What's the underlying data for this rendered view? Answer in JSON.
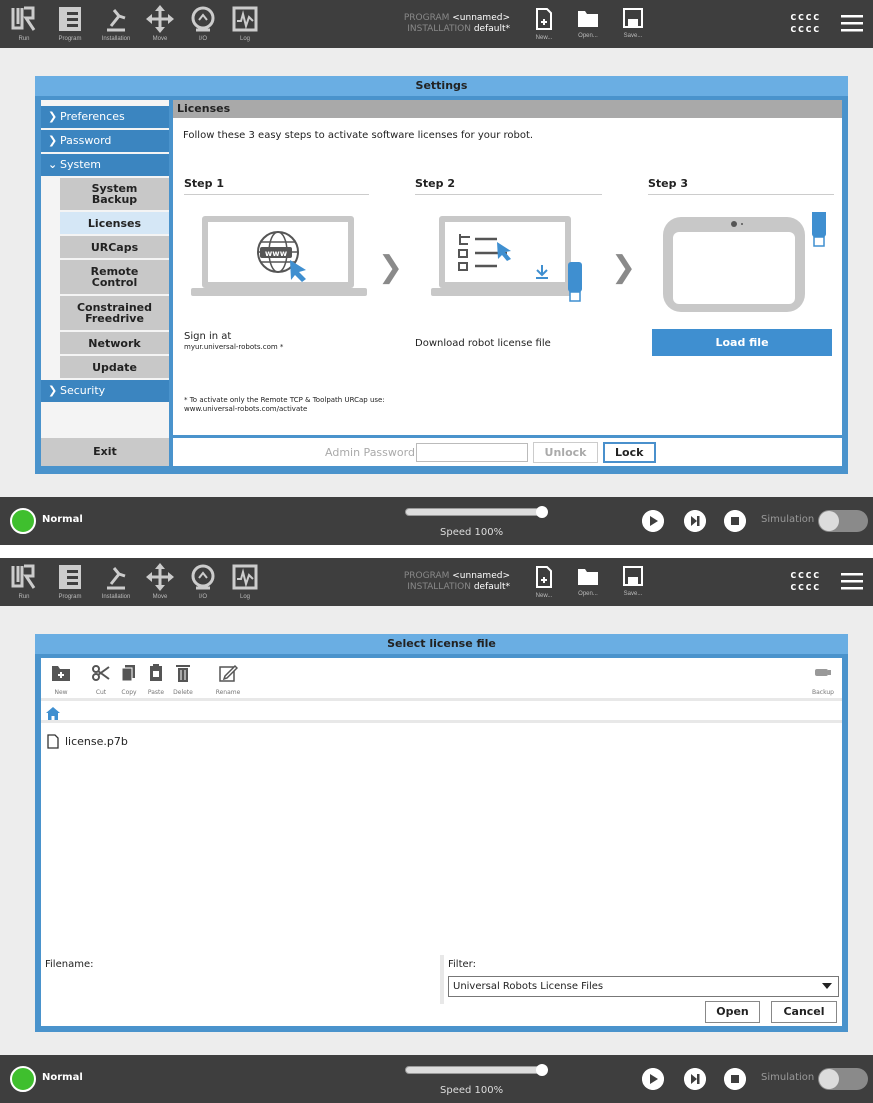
{
  "header": {
    "tabs": [
      {
        "label": "Run",
        "icon": "run-icon"
      },
      {
        "label": "Program",
        "icon": "program-icon"
      },
      {
        "label": "Installation",
        "icon": "installation-icon"
      },
      {
        "label": "Move",
        "icon": "move-icon"
      },
      {
        "label": "I/O",
        "icon": "io-icon"
      },
      {
        "label": "Log",
        "icon": "log-icon"
      }
    ],
    "program_key": "PROGRAM",
    "program_value": "<unnamed>",
    "installation_key": "INSTALLATION",
    "installation_value": "default*",
    "file_actions": [
      {
        "label": "New...",
        "icon": "new-file-icon"
      },
      {
        "label": "Open...",
        "icon": "open-folder-icon"
      },
      {
        "label": "Save...",
        "icon": "save-icon"
      }
    ],
    "user_line1": "cccc",
    "user_line2": "cccc"
  },
  "footer": {
    "status": "Normal",
    "speed": "Speed 100%",
    "speed_fraction": 1.0,
    "simulation": "Simulation",
    "status_color": "#3fbf2e"
  },
  "settings": {
    "title": "Settings",
    "nav": {
      "preferences": "Preferences",
      "password": "Password",
      "system": "System",
      "security": "Security",
      "sub": {
        "backup": "System Backup",
        "licenses": "Licenses",
        "urcaps": "URCaps",
        "remote": "Remote Control",
        "freedrive": "Constrained Freedrive",
        "network": "Network",
        "update": "Update"
      }
    },
    "exit": "Exit",
    "section_title": "Licenses",
    "intro": "Follow these 3 easy steps to activate software licenses for your robot.",
    "step1": "Step 1",
    "step2": "Step 2",
    "step3": "Step 3",
    "www": "www",
    "signin": "Sign in at",
    "signin_url": "myur.universal-robots.com *",
    "download": "Download robot license file",
    "load_file": "Load file",
    "footnote_line1": "* To activate only the Remote TCP & Toolpath URCap use:",
    "footnote_line2": "www.universal-robots.com/activate",
    "admin_password": "Admin Password",
    "unlock": "Unlock",
    "lock": "Lock",
    "accent": "#4a93cc"
  },
  "filedialog": {
    "title": "Select license file",
    "tools": {
      "new": "New",
      "cut": "Cut",
      "copy": "Copy",
      "paste": "Paste",
      "delete": "Delete",
      "rename": "Rename",
      "backup": "Backup"
    },
    "file": "license.p7b",
    "filename_label": "Filename:",
    "filter_label": "Filter:",
    "filter_value": "Universal Robots License Files",
    "open": "Open",
    "cancel": "Cancel"
  }
}
